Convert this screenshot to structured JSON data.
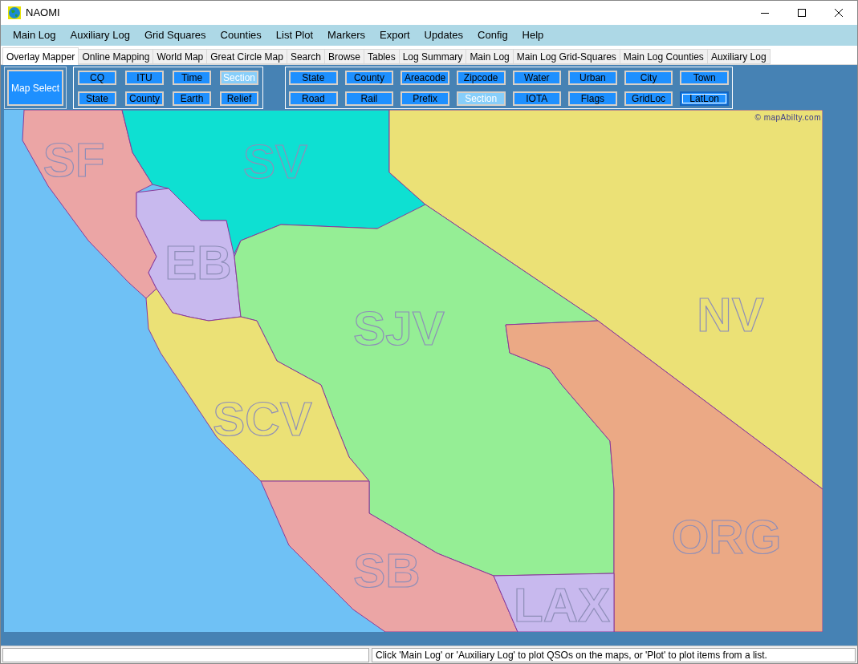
{
  "window": {
    "title": "NAOMI"
  },
  "menu": [
    "Main Log",
    "Auxiliary Log",
    "Grid Squares",
    "Counties",
    "List Plot",
    "Markers",
    "Export",
    "Updates",
    "Config",
    "Help"
  ],
  "tabs": [
    {
      "label": "Overlay Mapper",
      "selected": true
    },
    {
      "label": "Online Mapping",
      "selected": false
    },
    {
      "label": "World Map",
      "selected": false
    },
    {
      "label": "Great Circle Map",
      "selected": false
    },
    {
      "label": "Search",
      "selected": false
    },
    {
      "label": "Browse",
      "selected": false
    },
    {
      "label": "Tables",
      "selected": false
    },
    {
      "label": "Log Summary",
      "selected": false
    },
    {
      "label": "Main Log",
      "selected": false
    },
    {
      "label": "Main Log Grid-Squares",
      "selected": false
    },
    {
      "label": "Main Log Counties",
      "selected": false
    },
    {
      "label": "Auxiliary Log",
      "selected": false
    }
  ],
  "map_select_button": "Map Select",
  "base_layers": [
    {
      "label": "CQ",
      "disabled": false,
      "focused": false
    },
    {
      "label": "ITU",
      "disabled": false,
      "focused": false
    },
    {
      "label": "Time",
      "disabled": false,
      "focused": false
    },
    {
      "label": "Section",
      "disabled": true,
      "focused": false
    },
    {
      "label": "State",
      "disabled": false,
      "focused": false
    },
    {
      "label": "County",
      "disabled": false,
      "focused": false
    },
    {
      "label": "Earth",
      "disabled": false,
      "focused": false
    },
    {
      "label": "Relief",
      "disabled": false,
      "focused": false
    }
  ],
  "overlay_layers": [
    {
      "label": "State",
      "disabled": false,
      "focused": false
    },
    {
      "label": "County",
      "disabled": false,
      "focused": false
    },
    {
      "label": "Areacode",
      "disabled": false,
      "focused": false
    },
    {
      "label": "Zipcode",
      "disabled": false,
      "focused": false
    },
    {
      "label": "Water",
      "disabled": false,
      "focused": false
    },
    {
      "label": "Urban",
      "disabled": false,
      "focused": false
    },
    {
      "label": "City",
      "disabled": false,
      "focused": false
    },
    {
      "label": "Town",
      "disabled": false,
      "focused": false
    },
    {
      "label": "Road",
      "disabled": false,
      "focused": false
    },
    {
      "label": "Rail",
      "disabled": false,
      "focused": false
    },
    {
      "label": "Prefix",
      "disabled": false,
      "focused": false
    },
    {
      "label": "Section",
      "disabled": true,
      "focused": false
    },
    {
      "label": "IOTA",
      "disabled": false,
      "focused": false
    },
    {
      "label": "Flags",
      "disabled": false,
      "focused": false
    },
    {
      "label": "GridLoc",
      "disabled": false,
      "focused": false
    },
    {
      "label": "LatLon",
      "disabled": false,
      "focused": true
    }
  ],
  "map": {
    "credit": "© mapAbilty.com",
    "regions": [
      {
        "label": "SF",
        "color": "#eba5a5"
      },
      {
        "label": "SV",
        "color": "#0ee0d2"
      },
      {
        "label": "EB",
        "color": "#c8b9ee"
      },
      {
        "label": "NV",
        "color": "#ebe176"
      },
      {
        "label": "SJV",
        "color": "#95ee95"
      },
      {
        "label": "ORG",
        "color": "#eba985"
      },
      {
        "label": "SCV",
        "color": "#ebe176"
      },
      {
        "label": "SB",
        "color": "#eba5a5"
      },
      {
        "label": "LAX",
        "color": "#c8b9ee"
      }
    ]
  },
  "status_bar": {
    "message": "Click 'Main Log' or 'Auxiliary Log' to plot QSOs on the maps, or 'Plot' to plot items from a list."
  }
}
